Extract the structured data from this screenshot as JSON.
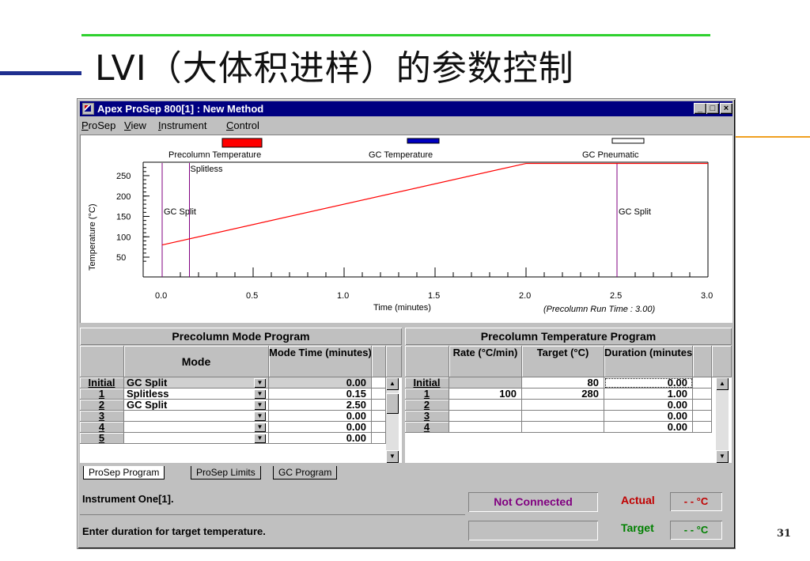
{
  "slide": {
    "title": "LVI（大体积进样）的参数控制",
    "page_number": "31"
  },
  "window": {
    "title": "Apex ProSep 800[1] : New Method",
    "menu": [
      "ProSep",
      "View",
      "Instrument",
      "Control"
    ]
  },
  "legend": [
    {
      "label": "Precolumn Temperature",
      "color": "#ff0000"
    },
    {
      "label": "GC Temperature",
      "color": "#0000c0"
    },
    {
      "label": "GC Pneumatic",
      "color": "#ffffff"
    }
  ],
  "chart_data": {
    "type": "line",
    "ylabel": "Temperature (°C)",
    "xlabel": "Time (minutes)",
    "run_time_note": "(Precolumn Run Time : 3.00)",
    "xlim": [
      0,
      3.0
    ],
    "ylim": [
      0,
      280
    ],
    "x_ticks": [
      "0.0",
      "0.5",
      "1.0",
      "1.5",
      "2.0",
      "2.5",
      "3.0"
    ],
    "y_ticks": [
      "250",
      "200",
      "150",
      "100",
      "50"
    ],
    "series": [
      {
        "name": "Precolumn Temperature",
        "x": [
          0.0,
          2.0,
          3.0
        ],
        "y": [
          80,
          280,
          280
        ]
      }
    ],
    "markers": [
      {
        "x": 0.0,
        "label": "GC Split"
      },
      {
        "x": 0.15,
        "label": "Splitless"
      },
      {
        "x": 2.5,
        "label": "GC Split"
      }
    ]
  },
  "mode_program": {
    "title": "Precolumn Mode Program",
    "headers": [
      "Mode",
      "Mode Time (minutes)"
    ],
    "rows": [
      {
        "row": "Initial",
        "mode": "GC Split",
        "time": "0.00"
      },
      {
        "row": "1",
        "mode": "Splitless",
        "time": "0.15"
      },
      {
        "row": "2",
        "mode": "GC Split",
        "time": "2.50"
      },
      {
        "row": "3",
        "mode": "",
        "time": "0.00"
      },
      {
        "row": "4",
        "mode": "",
        "time": "0.00"
      },
      {
        "row": "5",
        "mode": "",
        "time": "0.00"
      }
    ]
  },
  "temp_program": {
    "title": "Precolumn Temperature Program",
    "headers": [
      "Rate (°C/min)",
      "Target (°C)",
      "Duration (minutes)"
    ],
    "rows": [
      {
        "row": "Initial",
        "rate": "",
        "target": "80",
        "duration": "0.00"
      },
      {
        "row": "1",
        "rate": "100",
        "target": "280",
        "duration": "1.00"
      },
      {
        "row": "2",
        "rate": "",
        "target": "",
        "duration": "0.00"
      },
      {
        "row": "3",
        "rate": "",
        "target": "",
        "duration": "0.00"
      },
      {
        "row": "4",
        "rate": "",
        "target": "",
        "duration": "0.00"
      }
    ]
  },
  "tabs": [
    "ProSep Program",
    "ProSep Limits",
    "GC Program"
  ],
  "status": {
    "instrument": "Instrument One[1].",
    "hint": "Enter duration for target temperature.",
    "connection": "Not Connected",
    "actual_label": "Actual",
    "actual_value": "- - °C",
    "target_label": "Target",
    "target_value": "- - °C"
  }
}
